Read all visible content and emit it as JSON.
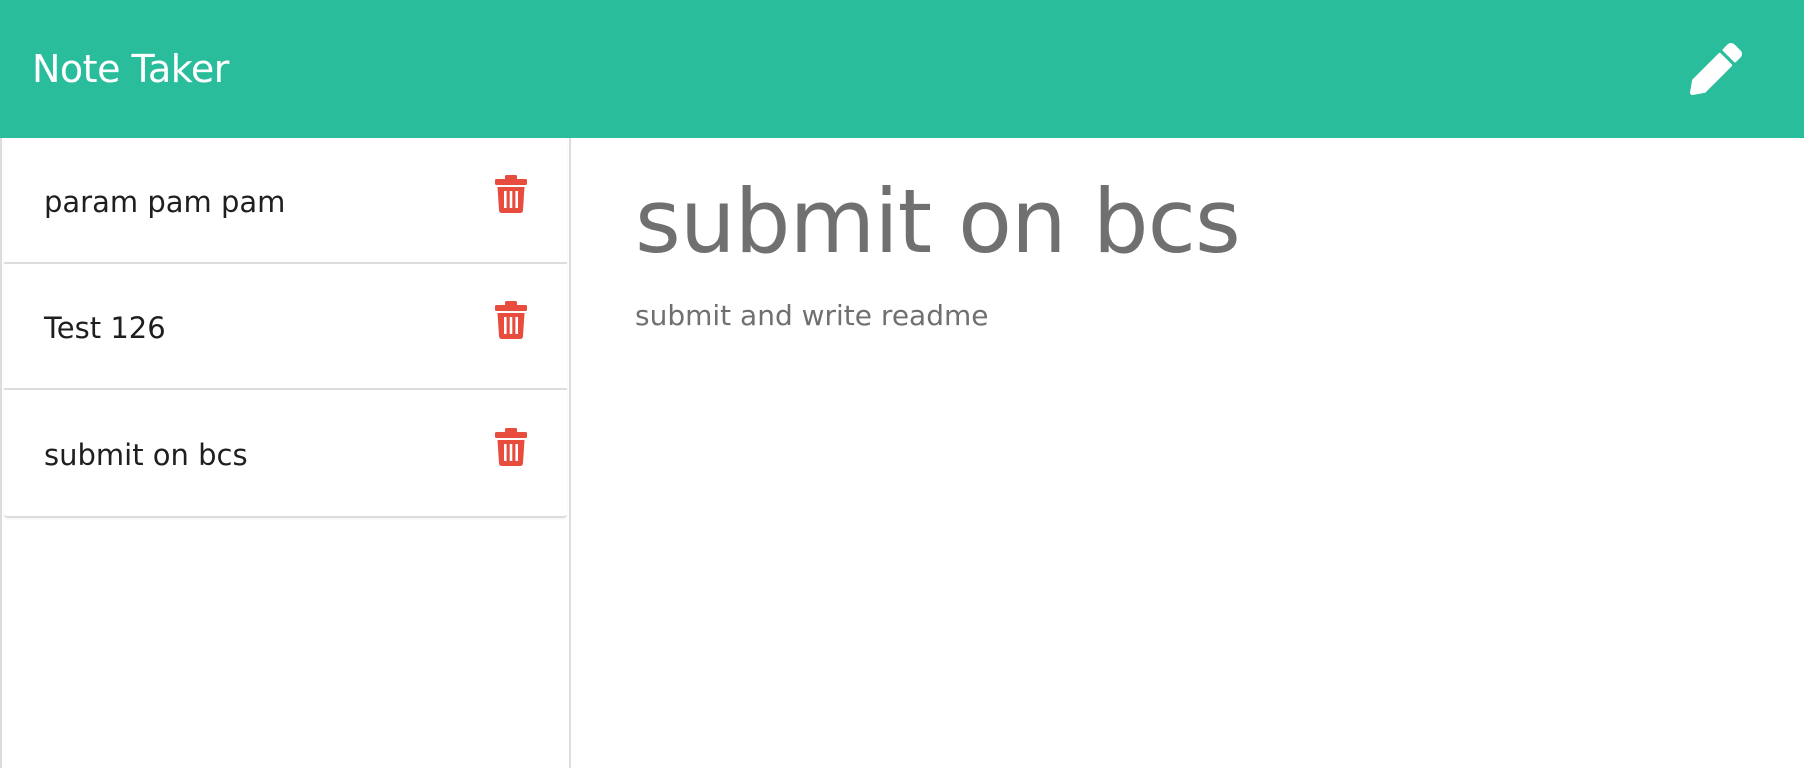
{
  "navbar": {
    "brand": "Note Taker",
    "new_note_icon": "pencil-icon",
    "color": "#2abd9b"
  },
  "sidebar": {
    "notes": [
      {
        "title": "param pam pam",
        "delete_icon": "trash-icon"
      },
      {
        "title": "Test 126",
        "delete_icon": "trash-icon"
      },
      {
        "title": "submit on bcs",
        "delete_icon": "trash-icon"
      }
    ],
    "delete_color": "#e74c3c"
  },
  "editor": {
    "title_value": "submit on bcs",
    "text_value": "submit and write readme"
  }
}
